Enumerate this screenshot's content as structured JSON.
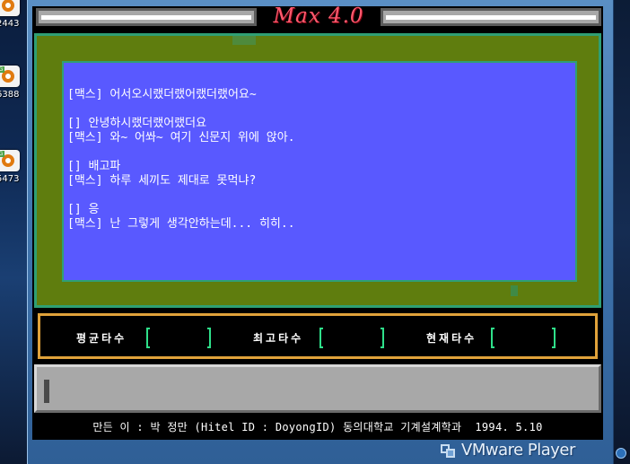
{
  "app": {
    "title": "Max 4.0",
    "credits": "만든 이 : 박 정만 (Hitel ID : DoyongID) 동의대학교 기계설계학과  1994. 5.10"
  },
  "chat": {
    "lines": [
      "[맥스] 어서오시랬더랬어랬더랬어요~",
      "",
      "[] 안녕하시랬더랬어랬더요",
      "[맥스] 와~ 어쏴~ 여기 신문지 위에 앉아.",
      "",
      "[] 배고파",
      "[맥스] 하루 세끼도 제대로 못먹냐?",
      "",
      "[] 응",
      "[맥스] 난 그렇게 생각안하는데... 히히.."
    ]
  },
  "stats": {
    "avg_label": "평균타수",
    "max_label": "최고타수",
    "current_label": "현재타수",
    "avg_value": "",
    "max_value": "",
    "current_value": ""
  },
  "input": {
    "value": ""
  },
  "host": {
    "player_name": "VMware Player",
    "desktop_labels": [
      "2443",
      "6388",
      "5473"
    ]
  },
  "colors": {
    "title": "#ff5a6e",
    "board_green": "#5f7d0e",
    "chat_bg": "#5959ff",
    "stats_border": "#e0a23a",
    "bracket": "#2fe08a"
  }
}
